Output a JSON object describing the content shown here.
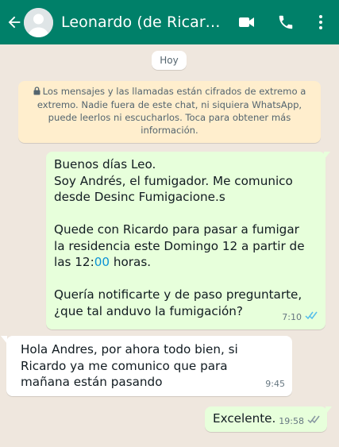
{
  "header": {
    "contact_name": "Leonardo (de Ricardo)...",
    "background_color": "#008069",
    "icons": [
      "back-arrow-icon",
      "default-avatar-icon",
      "video-call-icon",
      "phone-call-icon",
      "more-vert-icon"
    ]
  },
  "chat": {
    "date_chip": "Hoy",
    "encryption_notice": "Los mensajes y las llamadas están cifrados de extremo a extremo. Nadie fuera de este chat, ni siquiera WhatsApp, puede leerlos ni escucharlos. Toca para obtener más información.",
    "messages": [
      {
        "direction": "outgoing",
        "lines": [
          "Buenos días Leo.",
          "Soy Andrés, el fumigador. Me comunico",
          "desde Desinc Fumigacione.s",
          "",
          "Quede con Ricardo para pasar a fumigar",
          "la residencia este Domingo 12 a partir de",
          "las 12:00 horas.",
          "",
          "Quería notificarte y de paso preguntarte,",
          "¿que tal anduvo la fumigación?"
        ],
        "line7_prefix": "las 12:",
        "line7_accent": "00",
        "line7_suffix": " horas.",
        "time": "7:10",
        "status": "read"
      },
      {
        "direction": "incoming",
        "lines": [
          "Hola Andres, por ahora todo bien, si",
          "Ricardo ya me comunico que para",
          "mañana están pasando"
        ],
        "time": "9:45"
      },
      {
        "direction": "outgoing",
        "lines": [
          "Excelente."
        ],
        "time": "19:58",
        "status": "delivered"
      }
    ]
  },
  "colors": {
    "chat_background": "#efe7de",
    "outgoing_bubble": "#e7ffdb",
    "incoming_bubble": "#ffffff",
    "notice_background": "#ffeecd",
    "read_tick": "#53bdeb",
    "delivered_tick": "#8696a0"
  }
}
